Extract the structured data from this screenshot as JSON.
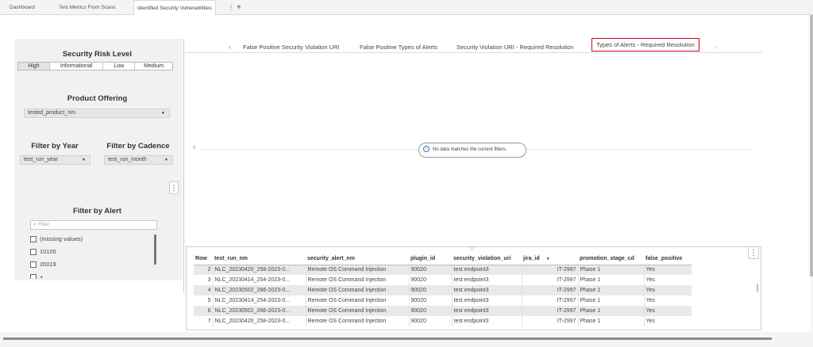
{
  "top_tabs": [
    {
      "label": "Dashboard"
    },
    {
      "label": "Test Metrics From Scans"
    },
    {
      "label": "Identified Security Vulnerabilities"
    }
  ],
  "top_tab_menu": "⋮",
  "add_tab": "+",
  "controls": {
    "risk": {
      "title": "Security Risk Level",
      "options": [
        "High",
        "Informational",
        "Low",
        "Medium"
      ],
      "selected": "High"
    },
    "product": {
      "title": "Product Offering",
      "value": "tested_product_nm"
    },
    "year": {
      "title": "Filter by Year",
      "value": "test_run_year"
    },
    "cadence": {
      "title": "Filter by Cadence",
      "value": "test_run_month"
    },
    "more": "⋮",
    "alert": {
      "title": "Filter by Alert",
      "placeholder": "Filter",
      "items": [
        "(missing values)",
        "10105",
        "20019",
        "+"
      ]
    }
  },
  "report_tabs": {
    "prev": "‹",
    "next": "›",
    "items": [
      "False Positive Security Violation URI",
      "False Positive Types of Alerts",
      "Security Violation URI - Required Resolution",
      "Types of Alerts - Required Resolution"
    ],
    "active_index": 3
  },
  "empty_state": {
    "message": "No data matches the current filters.",
    "icon": "info-icon",
    "axis_zero": "0"
  },
  "table": {
    "grip": "⁝⁝⁝",
    "menu": "⋮",
    "columns": [
      "Row",
      "test_run_nm",
      "security_alert_nm",
      "plugin_id",
      "security_violation_uri",
      "jira_id",
      "promotion_stage_cd",
      "false_positive"
    ],
    "rows": [
      [
        "2",
        "NLC_20230420_258-2023-0...",
        "Remote OS Command Injection",
        "90020",
        "test endpoint3",
        "IT-2997",
        "Phase 1",
        "Yes"
      ],
      [
        "3",
        "NLC_20230414_254-2023-0...",
        "Remote OS Command Injection",
        "90020",
        "test endpoint3",
        "IT-2997",
        "Phase 1",
        "Yes"
      ],
      [
        "4",
        "NLC_20230502_266-2023-0...",
        "Remote OS Command Injection",
        "90020",
        "test endpoint3",
        "IT-2997",
        "Phase 1",
        "Yes"
      ],
      [
        "5",
        "NLC_20230414_254-2023-0...",
        "Remote OS Command Injection",
        "90020",
        "test endpoint3",
        "IT-2997",
        "Phase 1",
        "Yes"
      ],
      [
        "6",
        "NLC_20230502_266-2023-0...",
        "Remote OS Command Injection",
        "90020",
        "test endpoint3",
        "IT-2997",
        "Phase 1",
        "Yes"
      ],
      [
        "7",
        "NLC_20230420_258-2023-0...",
        "Remote OS Command Injection",
        "90020",
        "test endpoint3",
        "IT-2997",
        "Phase 1",
        "Yes"
      ]
    ]
  },
  "colors": {
    "active_tab_border": "#d0021b",
    "info_icon": "#3a79c9",
    "row_alt": "#e9e9e9"
  }
}
